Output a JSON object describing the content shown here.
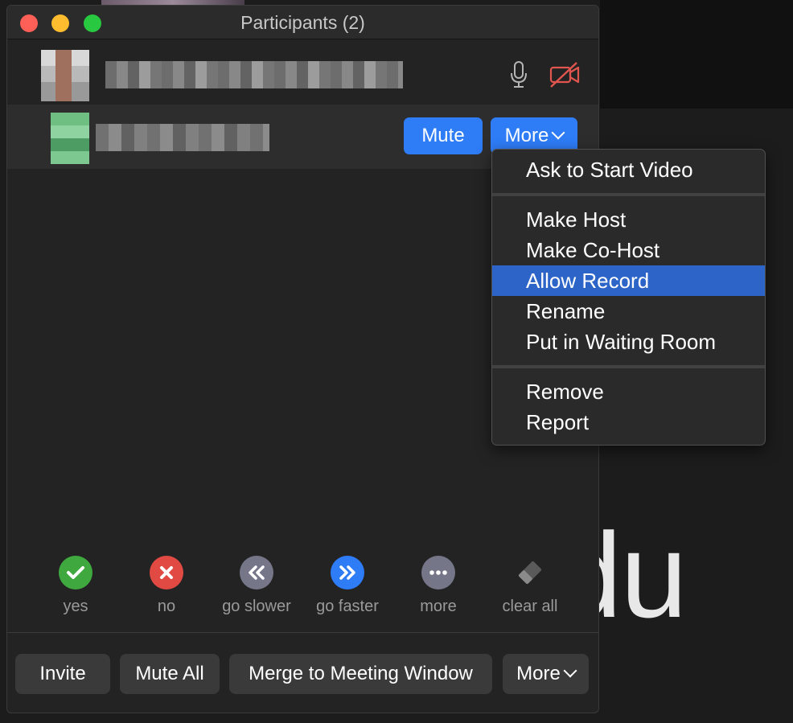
{
  "window": {
    "title": "Participants (2)"
  },
  "participants": [
    {
      "row": 1
    },
    {
      "row": 2,
      "mute_label": "Mute",
      "more_label": "More"
    }
  ],
  "context_menu": {
    "items": [
      "Ask to Start Video",
      "Make Host",
      "Make Co-Host",
      "Allow Record",
      "Rename",
      "Put in Waiting Room",
      "Remove",
      "Report"
    ],
    "selected": "Allow Record"
  },
  "reactions": [
    {
      "label": "yes",
      "icon": "check-icon",
      "color": "#3fa83e"
    },
    {
      "label": "no",
      "icon": "x-icon",
      "color": "#e04a43"
    },
    {
      "label": "go slower",
      "icon": "rewind-icon",
      "color": "#767689"
    },
    {
      "label": "go faster",
      "icon": "fast-forward-icon",
      "color": "#2e7cf6"
    },
    {
      "label": "more",
      "icon": "ellipsis-icon",
      "color": "#767689"
    },
    {
      "label": "clear all",
      "icon": "eraser-icon",
      "color": "#555555"
    }
  ],
  "footer": {
    "invite_label": "Invite",
    "mute_all_label": "Mute All",
    "merge_label": "Merge to Meeting Window",
    "more_label": "More"
  },
  "background": {
    "text": "du"
  },
  "colors": {
    "accent": "#2e7cf6",
    "menu_highlight": "#2c64c8",
    "cam_off": "#e0554e"
  }
}
